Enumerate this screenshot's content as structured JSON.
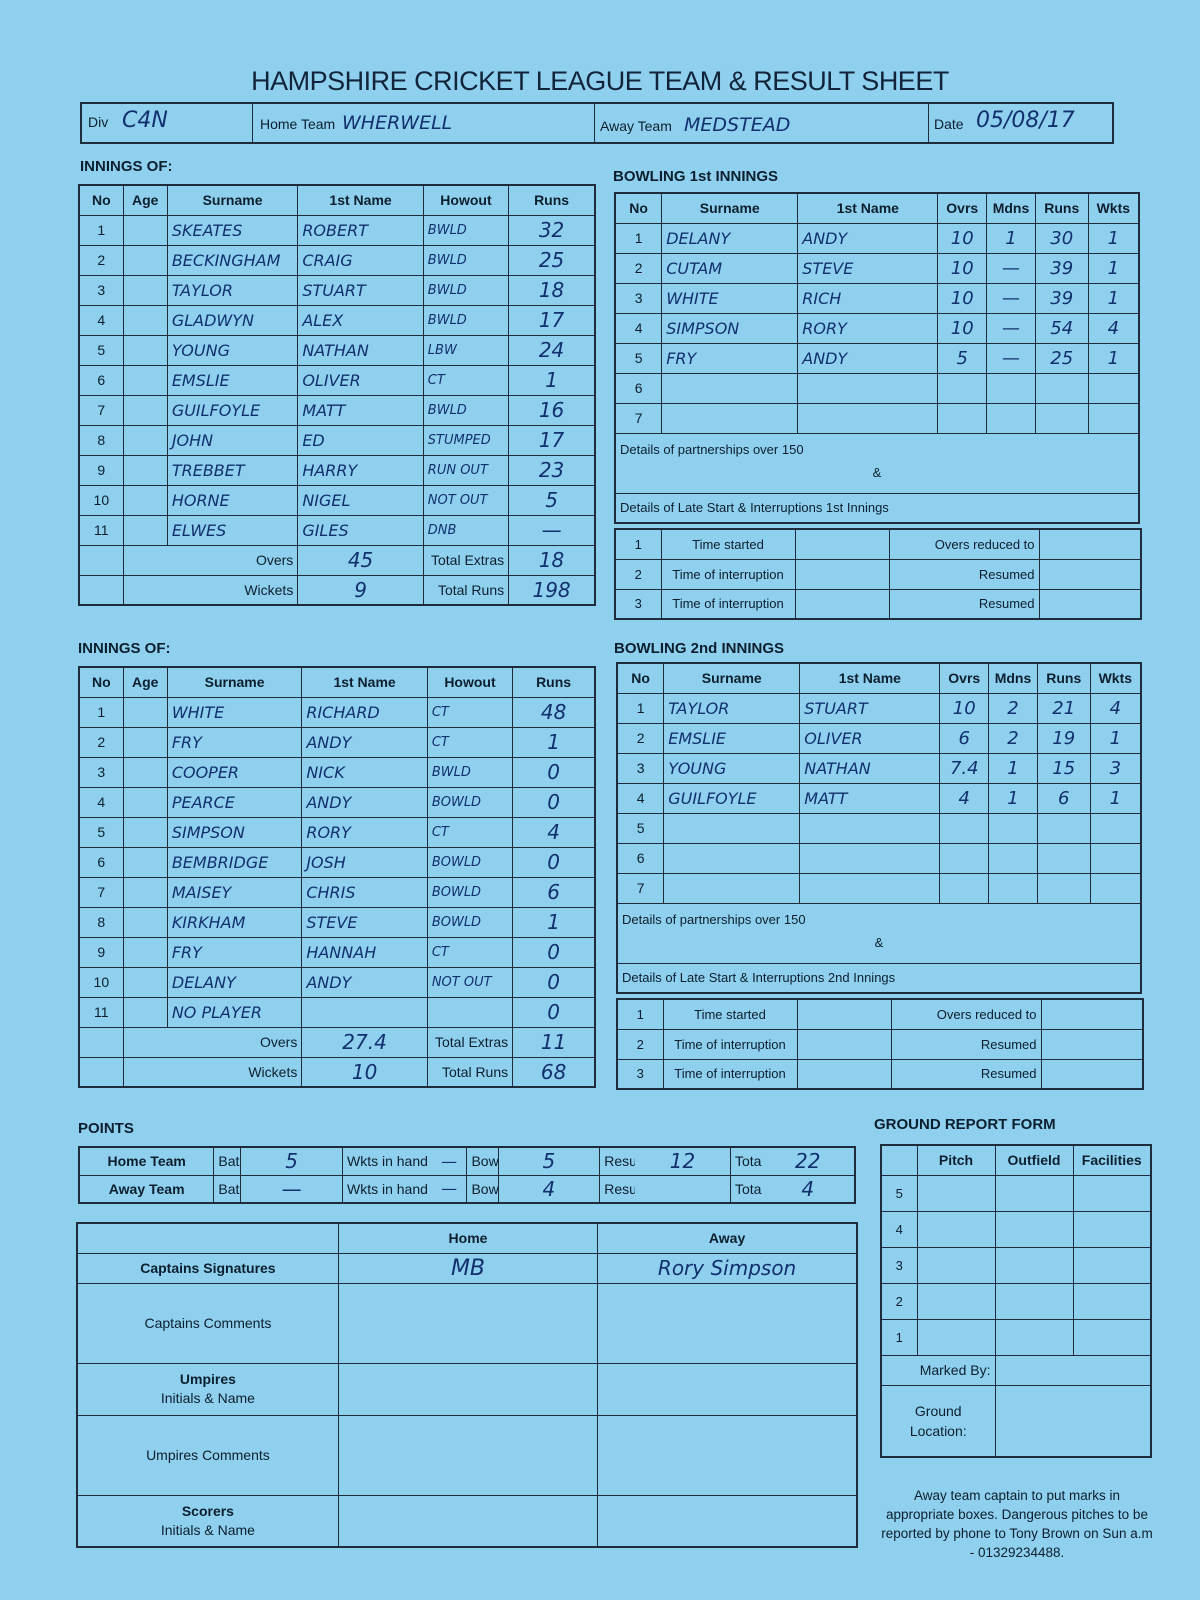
{
  "title": "HAMPSHIRE CRICKET LEAGUE TEAM & RESULT SHEET",
  "header": {
    "div_label": "Div",
    "div_value": "C4N",
    "home_label": "Home Team",
    "home_value": "WHERWELL",
    "away_label": "Away Team",
    "away_value": "MEDSTEAD",
    "date_label": "Date",
    "date_value": "05/08/17"
  },
  "innings_label": "INNINGS OF:",
  "batting_headers": [
    "No",
    "Age",
    "Surname",
    "1st Name",
    "Howout",
    "Runs"
  ],
  "innings1": {
    "rows": [
      {
        "no": "1",
        "surname": "SKEATES",
        "first": "ROBERT",
        "howout": "BWLD",
        "runs": "32"
      },
      {
        "no": "2",
        "surname": "BECKINGHAM",
        "first": "CRAIG",
        "howout": "BWLD",
        "runs": "25"
      },
      {
        "no": "3",
        "surname": "TAYLOR",
        "first": "STUART",
        "howout": "BWLD",
        "runs": "18"
      },
      {
        "no": "4",
        "surname": "GLADWYN",
        "first": "ALEX",
        "howout": "BWLD",
        "runs": "17"
      },
      {
        "no": "5",
        "surname": "YOUNG",
        "first": "NATHAN",
        "howout": "LBW",
        "runs": "24"
      },
      {
        "no": "6",
        "surname": "EMSLIE",
        "first": "OLIVER",
        "howout": "CT",
        "runs": "1"
      },
      {
        "no": "7",
        "surname": "GUILFOYLE",
        "first": "MATT",
        "howout": "BWLD",
        "runs": "16"
      },
      {
        "no": "8",
        "surname": "JOHN",
        "first": "ED",
        "howout": "STUMPED",
        "runs": "17"
      },
      {
        "no": "9",
        "surname": "TREBBET",
        "first": "HARRY",
        "howout": "RUN OUT",
        "runs": "23"
      },
      {
        "no": "10",
        "surname": "HORNE",
        "first": "NIGEL",
        "howout": "NOT OUT",
        "runs": "5"
      },
      {
        "no": "11",
        "surname": "ELWES",
        "first": "GILES",
        "howout": "DNB",
        "runs": "—"
      }
    ],
    "overs_label": "Overs",
    "overs": "45",
    "extras_label": "Total Extras",
    "extras": "18",
    "wickets_label": "Wickets",
    "wickets": "9",
    "total_label": "Total Runs",
    "total": "198"
  },
  "innings2": {
    "rows": [
      {
        "no": "1",
        "surname": "WHITE",
        "first": "RICHARD",
        "howout": "CT",
        "runs": "48"
      },
      {
        "no": "2",
        "surname": "FRY",
        "first": "ANDY",
        "howout": "CT",
        "runs": "1"
      },
      {
        "no": "3",
        "surname": "COOPER",
        "first": "NICK",
        "howout": "BWLD",
        "runs": "0"
      },
      {
        "no": "4",
        "surname": "PEARCE",
        "first": "ANDY",
        "howout": "BOWLD",
        "runs": "0"
      },
      {
        "no": "5",
        "surname": "SIMPSON",
        "first": "RORY",
        "howout": "CT",
        "runs": "4"
      },
      {
        "no": "6",
        "surname": "BEMBRIDGE",
        "first": "JOSH",
        "howout": "BOWLD",
        "runs": "0"
      },
      {
        "no": "7",
        "surname": "MAISEY",
        "first": "CHRIS",
        "howout": "BOWLD",
        "runs": "6"
      },
      {
        "no": "8",
        "surname": "KIRKHAM",
        "first": "STEVE",
        "howout": "BOWLD",
        "runs": "1"
      },
      {
        "no": "9",
        "surname": "FRY",
        "first": "HANNAH",
        "howout": "CT",
        "runs": "0"
      },
      {
        "no": "10",
        "surname": "DELANY",
        "first": "ANDY",
        "howout": "NOT OUT",
        "runs": "0"
      },
      {
        "no": "11",
        "surname": "NO PLAYER",
        "first": "",
        "howout": "",
        "runs": "0"
      }
    ],
    "overs_label": "Overs",
    "overs": "27.4",
    "extras_label": "Total Extras",
    "extras": "11",
    "wickets_label": "Wickets",
    "wickets": "10",
    "total_label": "Total Runs",
    "total": "68"
  },
  "bowling_headers": [
    "No",
    "Surname",
    "1st Name",
    "Ovrs",
    "Mdns",
    "Runs",
    "Wkts"
  ],
  "bowling1": {
    "title": "BOWLING 1st INNINGS",
    "rows": [
      {
        "no": "1",
        "surname": "DELANY",
        "first": "ANDY",
        "ovrs": "10",
        "mdns": "1",
        "runs": "30",
        "wkts": "1"
      },
      {
        "no": "2",
        "surname": "CUTAM",
        "first": "STEVE",
        "ovrs": "10",
        "mdns": "—",
        "runs": "39",
        "wkts": "1"
      },
      {
        "no": "3",
        "surname": "WHITE",
        "first": "RICH",
        "ovrs": "10",
        "mdns": "—",
        "runs": "39",
        "wkts": "1"
      },
      {
        "no": "4",
        "surname": "SIMPSON",
        "first": "RORY",
        "ovrs": "10",
        "mdns": "—",
        "runs": "54",
        "wkts": "4"
      },
      {
        "no": "5",
        "surname": "FRY",
        "first": "ANDY",
        "ovrs": "5",
        "mdns": "—",
        "runs": "25",
        "wkts": "1"
      },
      {
        "no": "6",
        "surname": "",
        "first": "",
        "ovrs": "",
        "mdns": "",
        "runs": "",
        "wkts": ""
      },
      {
        "no": "7",
        "surname": "",
        "first": "",
        "ovrs": "",
        "mdns": "",
        "runs": "",
        "wkts": ""
      }
    ],
    "partnerships": "Details of partnerships over 150",
    "amp": "&",
    "late_start": "Details of Late Start & Interruptions 1st Innings",
    "interruptions": [
      {
        "no": "1",
        "label": "Time started",
        "right": "Overs reduced to"
      },
      {
        "no": "2",
        "label": "Time of interruption",
        "right": "Resumed"
      },
      {
        "no": "3",
        "label": "Time of interruption",
        "right": "Resumed"
      }
    ]
  },
  "bowling2": {
    "title": "BOWLING 2nd INNINGS",
    "rows": [
      {
        "no": "1",
        "surname": "TAYLOR",
        "first": "STUART",
        "ovrs": "10",
        "mdns": "2",
        "runs": "21",
        "wkts": "4"
      },
      {
        "no": "2",
        "surname": "EMSLIE",
        "first": "OLIVER",
        "ovrs": "6",
        "mdns": "2",
        "runs": "19",
        "wkts": "1"
      },
      {
        "no": "3",
        "surname": "YOUNG",
        "first": "NATHAN",
        "ovrs": "7.4",
        "mdns": "1",
        "runs": "15",
        "wkts": "3"
      },
      {
        "no": "4",
        "surname": "GUILFOYLE",
        "first": "MATT",
        "ovrs": "4",
        "mdns": "1",
        "runs": "6",
        "wkts": "1"
      },
      {
        "no": "5",
        "surname": "",
        "first": "",
        "ovrs": "",
        "mdns": "",
        "runs": "",
        "wkts": ""
      },
      {
        "no": "6",
        "surname": "",
        "first": "",
        "ovrs": "",
        "mdns": "",
        "runs": "",
        "wkts": ""
      },
      {
        "no": "7",
        "surname": "",
        "first": "",
        "ovrs": "",
        "mdns": "",
        "runs": "",
        "wkts": ""
      }
    ],
    "partnerships": "Details of partnerships over 150",
    "amp": "&",
    "late_start": "Details of Late Start & Interruptions 2nd Innings",
    "interruptions": [
      {
        "no": "1",
        "label": "Time started",
        "right": "Overs reduced to"
      },
      {
        "no": "2",
        "label": "Time of interruption",
        "right": "Resumed"
      },
      {
        "no": "3",
        "label": "Time of interruption",
        "right": "Resumed"
      }
    ]
  },
  "points": {
    "title": "POINTS",
    "bat_label": "Bat",
    "wkts_label": "Wkts in hand",
    "bowl_label": "Bowl",
    "result_label": "Result",
    "total_label": "Total",
    "home": {
      "team": "Home Team",
      "bat": "5",
      "wkts": "—",
      "bowl": "5",
      "result": "12",
      "total": "22"
    },
    "away": {
      "team": "Away Team",
      "bat": "—",
      "wkts": "—",
      "bowl": "4",
      "result": "",
      "total": "4"
    }
  },
  "captains": {
    "home_header": "Home",
    "away_header": "Away",
    "signatures_label": "Captains Signatures",
    "home_signature": "MB",
    "away_signature": "Rory Simpson",
    "comments_label": "Captains Comments",
    "umpires_title": "Umpires",
    "umpires_sub": "Initials & Name",
    "umpires_comments": "Umpires Comments",
    "scorers_title": "Scorers",
    "scorers_sub": "Initials & Name"
  },
  "ground": {
    "title": "GROUND REPORT FORM",
    "headers": [
      "Pitch",
      "Outfield",
      "Facilities"
    ],
    "ratings": [
      "5",
      "4",
      "3",
      "2",
      "1"
    ],
    "marked_by": "Marked By:",
    "ground_location": "Ground Location:",
    "note": "Away team captain to put marks in appropriate boxes. Dangerous pitches to be reported by phone to Tony Brown on Sun a.m - 01329234488."
  },
  "colors": {
    "paper": "#8fd0ef",
    "ink": "#12306e",
    "lines": "#1e2c3c"
  }
}
